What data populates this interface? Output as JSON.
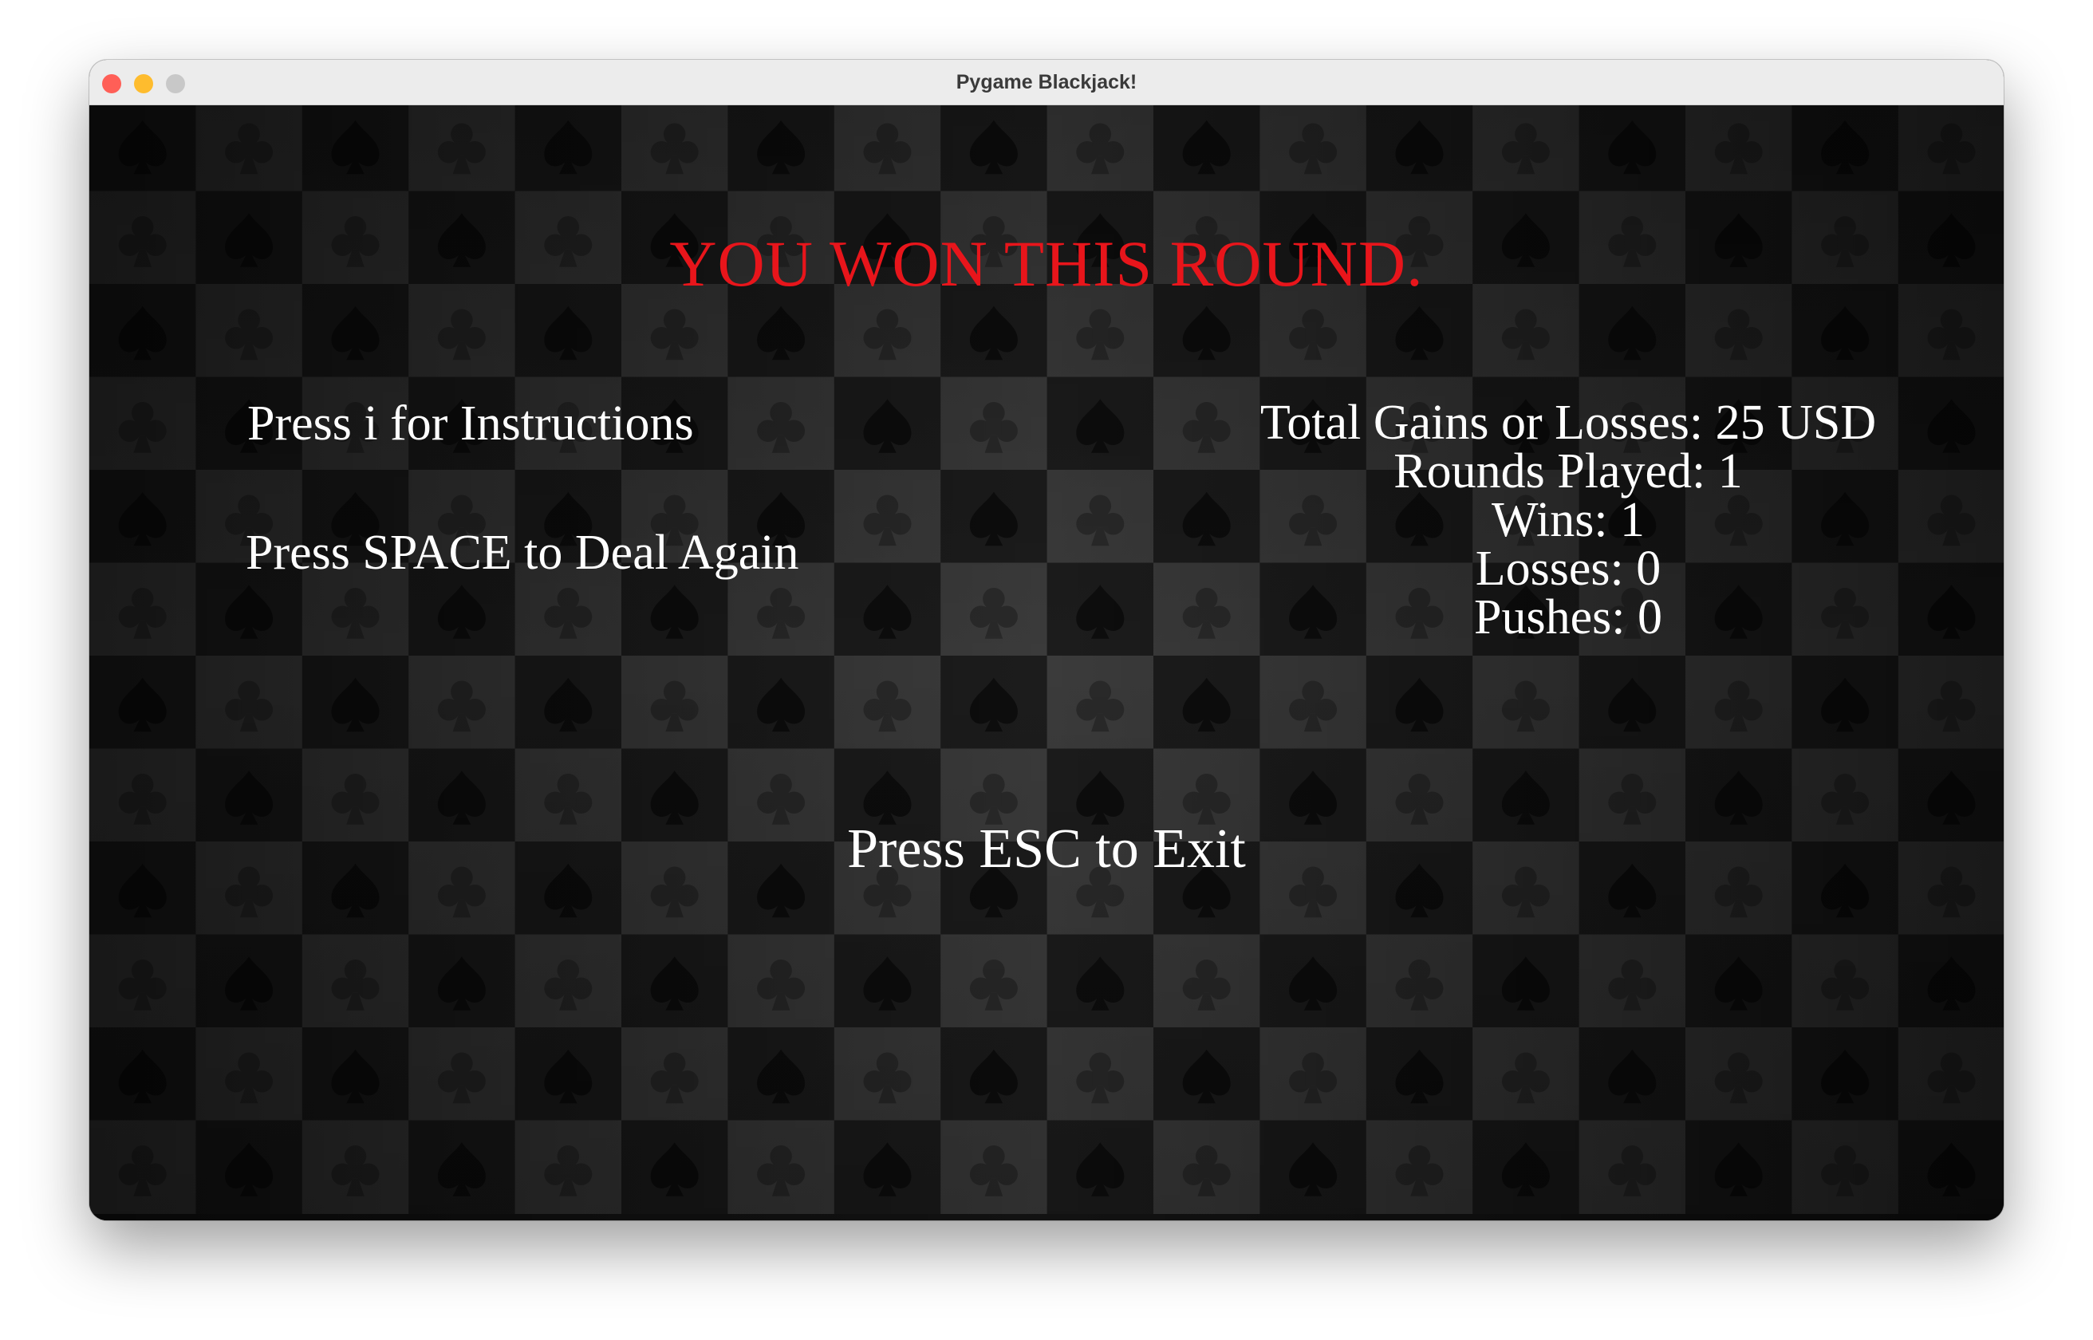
{
  "window": {
    "title": "Pygame Blackjack!",
    "controls": {
      "close_color": "#ff5f57",
      "minimize_color": "#febc2e",
      "maximize_color": "#c8c8c8"
    }
  },
  "game": {
    "background_pattern": [
      "spade-icon",
      "club-icon"
    ],
    "result_message": "YOU WON THIS ROUND.",
    "result_color": "#e8151b",
    "instructions_prompt": "Press i for Instructions",
    "deal_prompt": "Press SPACE to Deal Again",
    "exit_prompt": "Press ESC to Exit",
    "stats": {
      "total": "Total Gains or Losses: 25 USD",
      "rounds": "Rounds Played: 1",
      "wins": "Wins: 1",
      "losses": "Losses: 0",
      "pushes": "Pushes: 0"
    }
  }
}
